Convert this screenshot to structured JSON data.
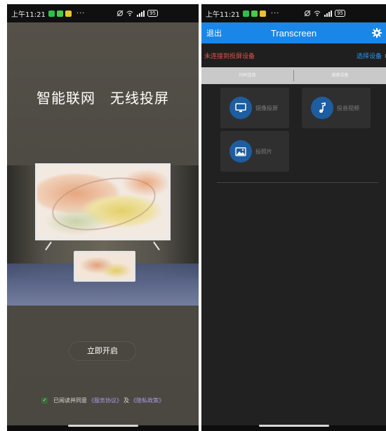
{
  "left_screen": {
    "status_bar": {
      "time": "上午11:21",
      "more": "···",
      "battery": "95"
    },
    "headline": "智能联网　无线投屏",
    "start_button": "立即开启",
    "agreement": {
      "prefix": "已阅读并同意",
      "service_link": "《服务协议》",
      "connector": "及",
      "privacy_link": "《隐私政策》"
    }
  },
  "right_screen": {
    "status_bar": {
      "time": "上午11:21",
      "more": "···",
      "battery": "95"
    },
    "app_bar": {
      "back": "退出",
      "title": "Transcreen"
    },
    "connection": {
      "status": "未连接到投屏设备",
      "choose_device": "选择设备"
    },
    "tabs": [
      {
        "label": "扫码连接"
      },
      {
        "label": "搜索设备"
      }
    ],
    "tiles": [
      {
        "label": "镜像投屏",
        "icon": "monitor-icon"
      },
      {
        "label": "投音视频",
        "icon": "music-note-icon"
      },
      {
        "label": "投照片",
        "icon": "photo-icon"
      }
    ]
  },
  "colors": {
    "accent_blue": "#1a87e8",
    "error_red": "#e2524a",
    "link_blue": "#2a95f0",
    "link_purple": "#a79de6"
  }
}
